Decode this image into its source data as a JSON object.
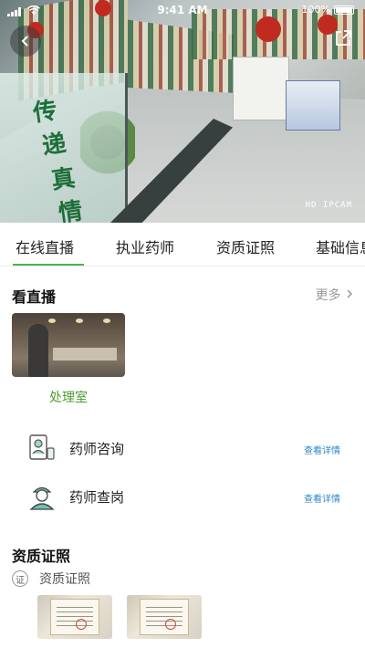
{
  "status_bar": {
    "time": "9:41 AM",
    "battery": "100%"
  },
  "video": {
    "camera_tag": "HD IPCAM",
    "glass_text": [
      "传",
      "递",
      "真",
      "情"
    ]
  },
  "tabs": [
    {
      "label": "在线直播"
    },
    {
      "label": "执业药师"
    },
    {
      "label": "资质证照"
    },
    {
      "label": "基础信息"
    }
  ],
  "live": {
    "title": "看直播",
    "more": "更多",
    "cards": [
      {
        "caption": "处理室"
      }
    ]
  },
  "services": [
    {
      "label": "药师咨询",
      "link": "查看详情",
      "icon": "pharmacist-consult-icon"
    },
    {
      "label": "药师查岗",
      "link": "查看详情",
      "icon": "pharmacist-check-icon"
    }
  ],
  "certificates": {
    "title": "资质证照",
    "badge": "证",
    "subtitle": "资质证照"
  },
  "colors": {
    "accent": "#4caf50",
    "caption": "#4c9a2a",
    "link": "#2f86c9"
  }
}
